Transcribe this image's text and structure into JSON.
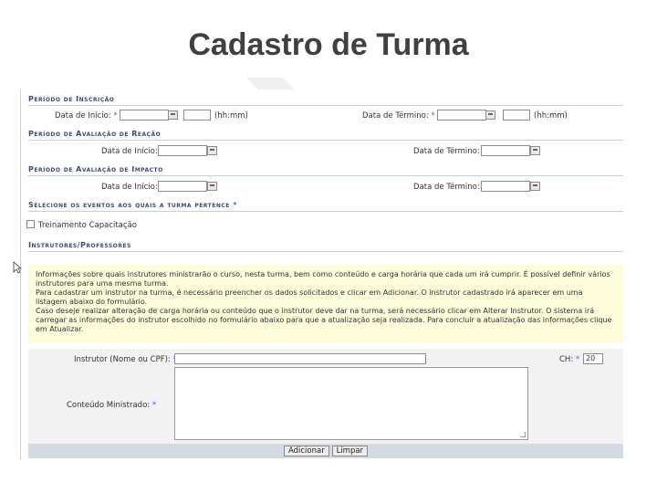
{
  "slide": {
    "title": "Cadastro de Turma"
  },
  "sections": {
    "inscricao": "Período de Inscrição",
    "reacao": "Período de Avaliação de Reação",
    "impacto": "Período de Avaliação de Impacto",
    "eventos": "Selecione os eventos aos quais a turma pertence",
    "instrutores": "Instrutores/Professores"
  },
  "fields": {
    "data_inicio_req": "Data de Início:",
    "data_termino_req": "Data de Término:",
    "hhmm": "(hh:mm)",
    "data_inicio": "Data de Início:",
    "data_termino": "Data de Término:",
    "required_star": "*"
  },
  "eventos": {
    "treinamento": "Treinamento Capacitação"
  },
  "info": {
    "line1": "Informações sobre quais instrutores ministrarão o curso, nesta turma, bem como conteúdo e carga horária que cada um irá cumprir. É possível definir vários instrutores para uma mesma turma.",
    "line2": "Para cadastrar um instrutor na turma, é necessário preencher os dados solicitados e clicar em Adicionar. O instrutor cadastrado irá aparecer em uma listagem abaixo do formulário.",
    "line3": "Caso deseje realizar alteração de carga horária ou conteúdo que o instrutor deve dar na turma, será necessário clicar em Alterar Instrutor. O sistema irá carregar as informações do instrutor escolhido no formulário abaixo para que a atualização seja realizada. Para concluir a atualização das informações clique em Atualizar."
  },
  "instrutor": {
    "nome_label": "Instrutor (Nome ou CPF):",
    "ch_label": "CH:",
    "ch_value": "20",
    "conteudo_label": "Conteúdo Ministrado:"
  },
  "buttons": {
    "adicionar": "Adicionar",
    "limpar": "Limpar"
  }
}
